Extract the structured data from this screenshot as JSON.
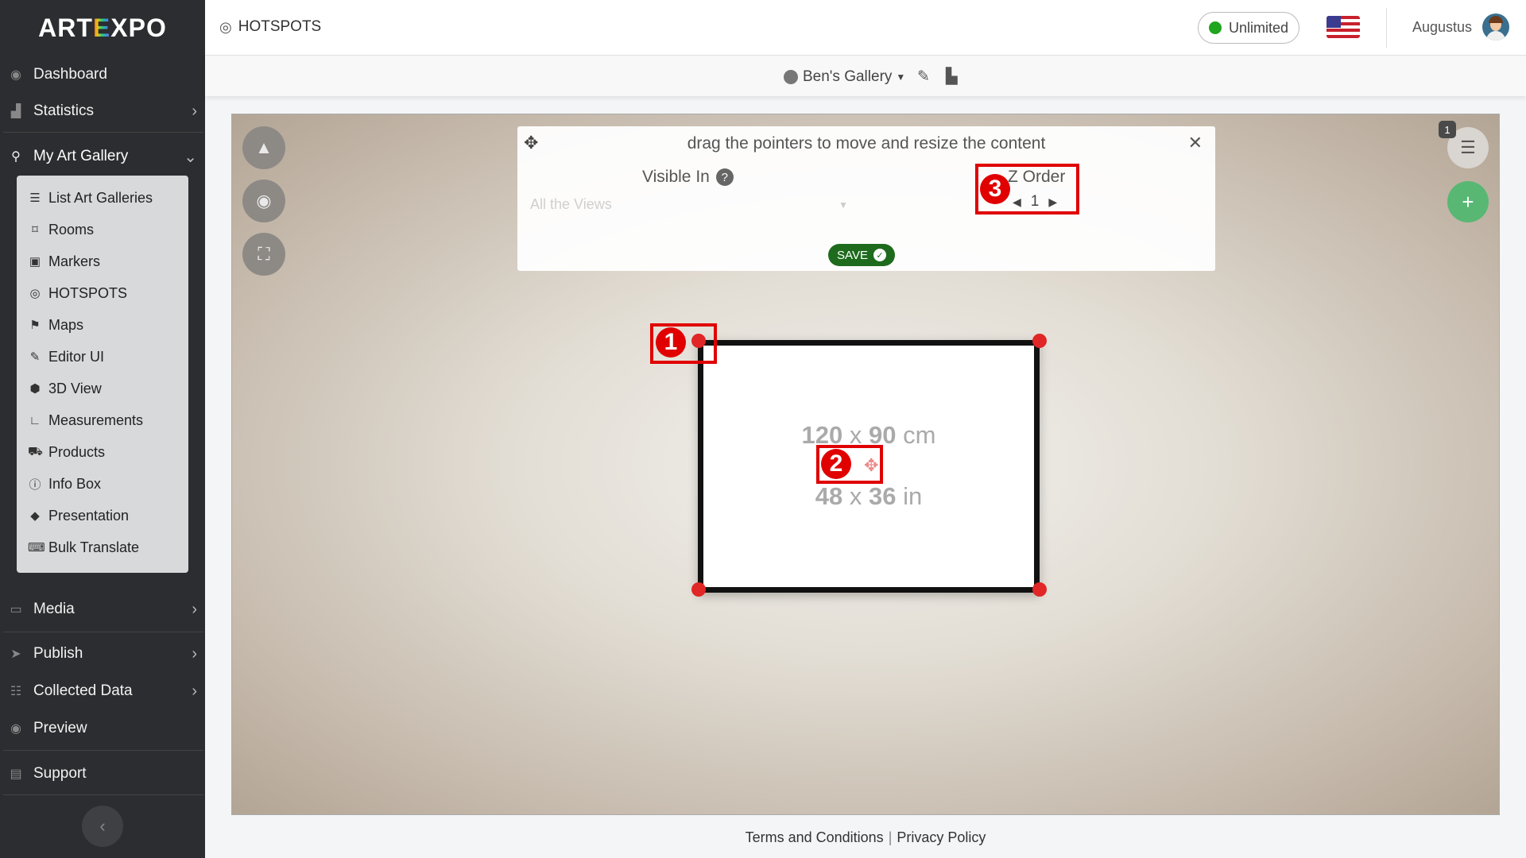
{
  "brand": {
    "logo_left": "ART",
    "logo_mid": "E",
    "logo_right": "XPO"
  },
  "sidebar": {
    "items": [
      {
        "label": "Dashboard"
      },
      {
        "label": "Statistics"
      },
      {
        "label": "My Art Gallery"
      },
      {
        "label": "Media"
      },
      {
        "label": "Publish"
      },
      {
        "label": "Collected Data"
      },
      {
        "label": "Preview"
      },
      {
        "label": "Support"
      }
    ],
    "submenu": [
      {
        "label": "List Art Galleries"
      },
      {
        "label": "Rooms"
      },
      {
        "label": "Markers"
      },
      {
        "label": "HOTSPOTS"
      },
      {
        "label": "Maps"
      },
      {
        "label": "Editor UI"
      },
      {
        "label": "3D View"
      },
      {
        "label": "Measurements"
      },
      {
        "label": "Products"
      },
      {
        "label": "Info Box"
      },
      {
        "label": "Presentation"
      },
      {
        "label": "Bulk Translate"
      }
    ]
  },
  "header": {
    "title": "HOTSPOTS",
    "plan": "Unlimited",
    "plan_status_color": "#1fa51f",
    "username": "Augustus"
  },
  "subbar": {
    "gallery": "Ben's Gallery"
  },
  "panel": {
    "instruction": "drag the pointers to move and resize the content",
    "visible_in_label": "Visible In",
    "help": "?",
    "views_value": "All the Views",
    "zorder_label": "Z Order",
    "zorder_value": "1",
    "save_label": "SAVE"
  },
  "canvas": {
    "badge_count": "1"
  },
  "artwork": {
    "cm_w": "120",
    "cm_x": "x",
    "cm_h": "90",
    "cm_unit": "cm",
    "in_w": "48",
    "in_x": "x",
    "in_h": "36",
    "in_unit": "in"
  },
  "annotations": [
    "1",
    "2",
    "3"
  ],
  "footer": {
    "terms": "Terms and Conditions",
    "separator": "|",
    "privacy": "Privacy Policy"
  },
  "colors": {
    "sidebar_bg": "#2b2d30",
    "accent_green": "#58b873",
    "save_green": "#1e6b1e",
    "annotation_red": "#e00000",
    "handle_red": "#e02626"
  },
  "icons": [
    "dashboard-icon",
    "chart-icon",
    "gallery-icon",
    "list-icon",
    "room-icon",
    "marker-icon",
    "hotspot-icon",
    "map-icon",
    "editor-icon",
    "cube-icon",
    "ruler-icon",
    "cart-icon",
    "info-icon",
    "diamond-icon",
    "translate-icon",
    "monitor-icon",
    "send-icon",
    "database-icon",
    "eye-icon",
    "support-icon",
    "move-icon",
    "close-icon",
    "plus-icon"
  ]
}
